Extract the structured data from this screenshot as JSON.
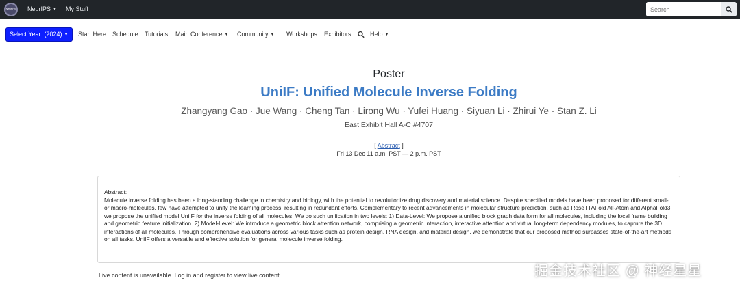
{
  "topbar": {
    "logo_text": "NeurIPS",
    "menu": [
      {
        "label": "NeurIPS",
        "has_dropdown": true
      },
      {
        "label": "My Stuff",
        "has_dropdown": false
      }
    ],
    "search": {
      "placeholder": "Search"
    }
  },
  "nav": {
    "year_button": "Select Year: (2024)",
    "links": [
      {
        "label": "Start Here"
      },
      {
        "label": "Schedule"
      },
      {
        "label": "Tutorials"
      },
      {
        "label": "Main Conference",
        "has_dropdown": true
      },
      {
        "label": "Community",
        "has_dropdown": true
      },
      {
        "label": "Workshops"
      },
      {
        "label": "Exhibitors"
      },
      {
        "label": "Help",
        "has_dropdown": true
      }
    ],
    "search_icon": "search-icon"
  },
  "poster": {
    "type_label": "Poster",
    "title": "UniIF: Unified Molecule Inverse Folding",
    "authors": "Zhangyang Gao · Jue Wang · Cheng Tan · Lirong Wu · Yufei Huang · Siyuan Li · Zhirui Ye · Stan Z. Li",
    "location": "East Exhibit Hall A-C #4707",
    "abstract_link": "Abstract",
    "time": "Fri 13 Dec 11 a.m. PST — 2 p.m. PST"
  },
  "abstract": {
    "heading": "Abstract:",
    "text": "Molecule inverse folding has been a long-standing challenge in chemistry and biology, with the potential to revolutionize drug discovery and material science. Despite specified models have been proposed for different small- or macro-molecules, few have attempted to unify the learning process, resulting in redundant efforts. Complementary to recent advancements in molecular structure prediction, such as RoseTTAFold All-Atom and AlphaFold3, we propose the unified model UniIF for the inverse folding of all molecules. We do such unification in two levels: 1) Data-Level: We propose a unified block graph data form for all molecules, including the local frame building and geometric feature initialization. 2) Model-Level: We introduce a geometric block attention network, comprising a geometric interaction, interactive attention and virtual long-term dependency modules, to capture the 3D interactions of all molecules. Through comprehensive evaluations across various tasks such as protein design, RNA design, and material design, we demonstrate that our proposed method surpasses state-of-the-art methods on all tasks. UniIF offers a versatile and effective solution for general molecule inverse folding."
  },
  "live_note": "Live content is unavailable. Log in and register to view live content",
  "watermark": "掘金技术社区 @ 神经星星",
  "colors": {
    "topbar_bg": "#212529",
    "year_button_bg": "#0d1fff",
    "title_blue": "#3c7bc5"
  }
}
